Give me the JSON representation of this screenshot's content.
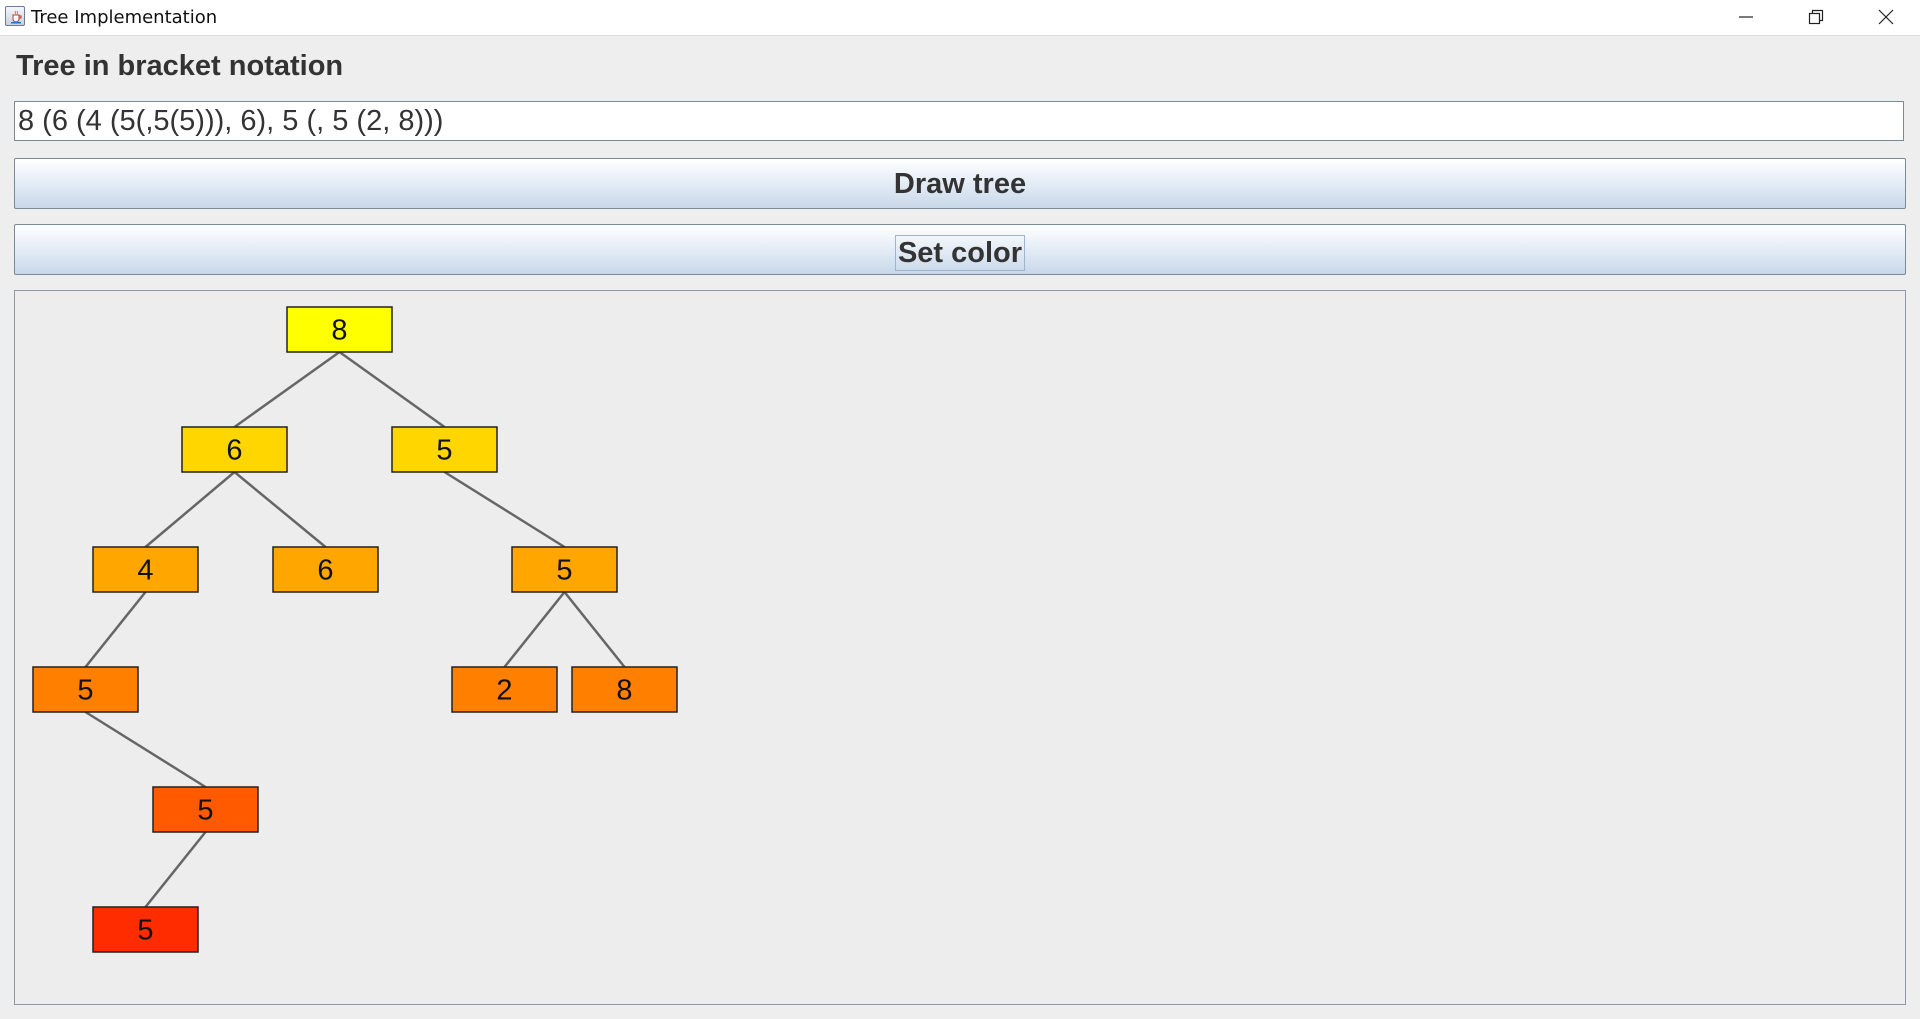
{
  "window": {
    "title": "Tree Implementation",
    "controls": [
      "minimize-icon",
      "restore-icon",
      "close-icon"
    ]
  },
  "form": {
    "heading": "Tree in bracket notation",
    "input_value": "8 (6 (4 (5(,5(5))), 6), 5 (, 5 (2, 8)))",
    "draw_button": "Draw tree",
    "color_button": "Set color"
  },
  "tree": {
    "nodes": [
      {
        "id": "n1",
        "label": "8",
        "color": "#FFFF00",
        "parent": null
      },
      {
        "id": "n2",
        "label": "6",
        "color": "#FFD600",
        "parent": "n1"
      },
      {
        "id": "n3",
        "label": "5",
        "color": "#FFD600",
        "parent": "n1"
      },
      {
        "id": "n4",
        "label": "4",
        "color": "#FFA600",
        "parent": "n2"
      },
      {
        "id": "n5",
        "label": "6",
        "color": "#FFA600",
        "parent": "n2"
      },
      {
        "id": "n6",
        "label": "5",
        "color": "#FFA600",
        "parent": "n3"
      },
      {
        "id": "n7",
        "label": "5",
        "color": "#FF8000",
        "parent": "n4"
      },
      {
        "id": "n8",
        "label": "2",
        "color": "#FF8000",
        "parent": "n6"
      },
      {
        "id": "n9",
        "label": "8",
        "color": "#FF8000",
        "parent": "n6"
      },
      {
        "id": "n10",
        "label": "5",
        "color": "#FF5A00",
        "parent": "n7"
      },
      {
        "id": "n11",
        "label": "5",
        "color": "#FF2C00",
        "parent": "n10"
      }
    ]
  }
}
